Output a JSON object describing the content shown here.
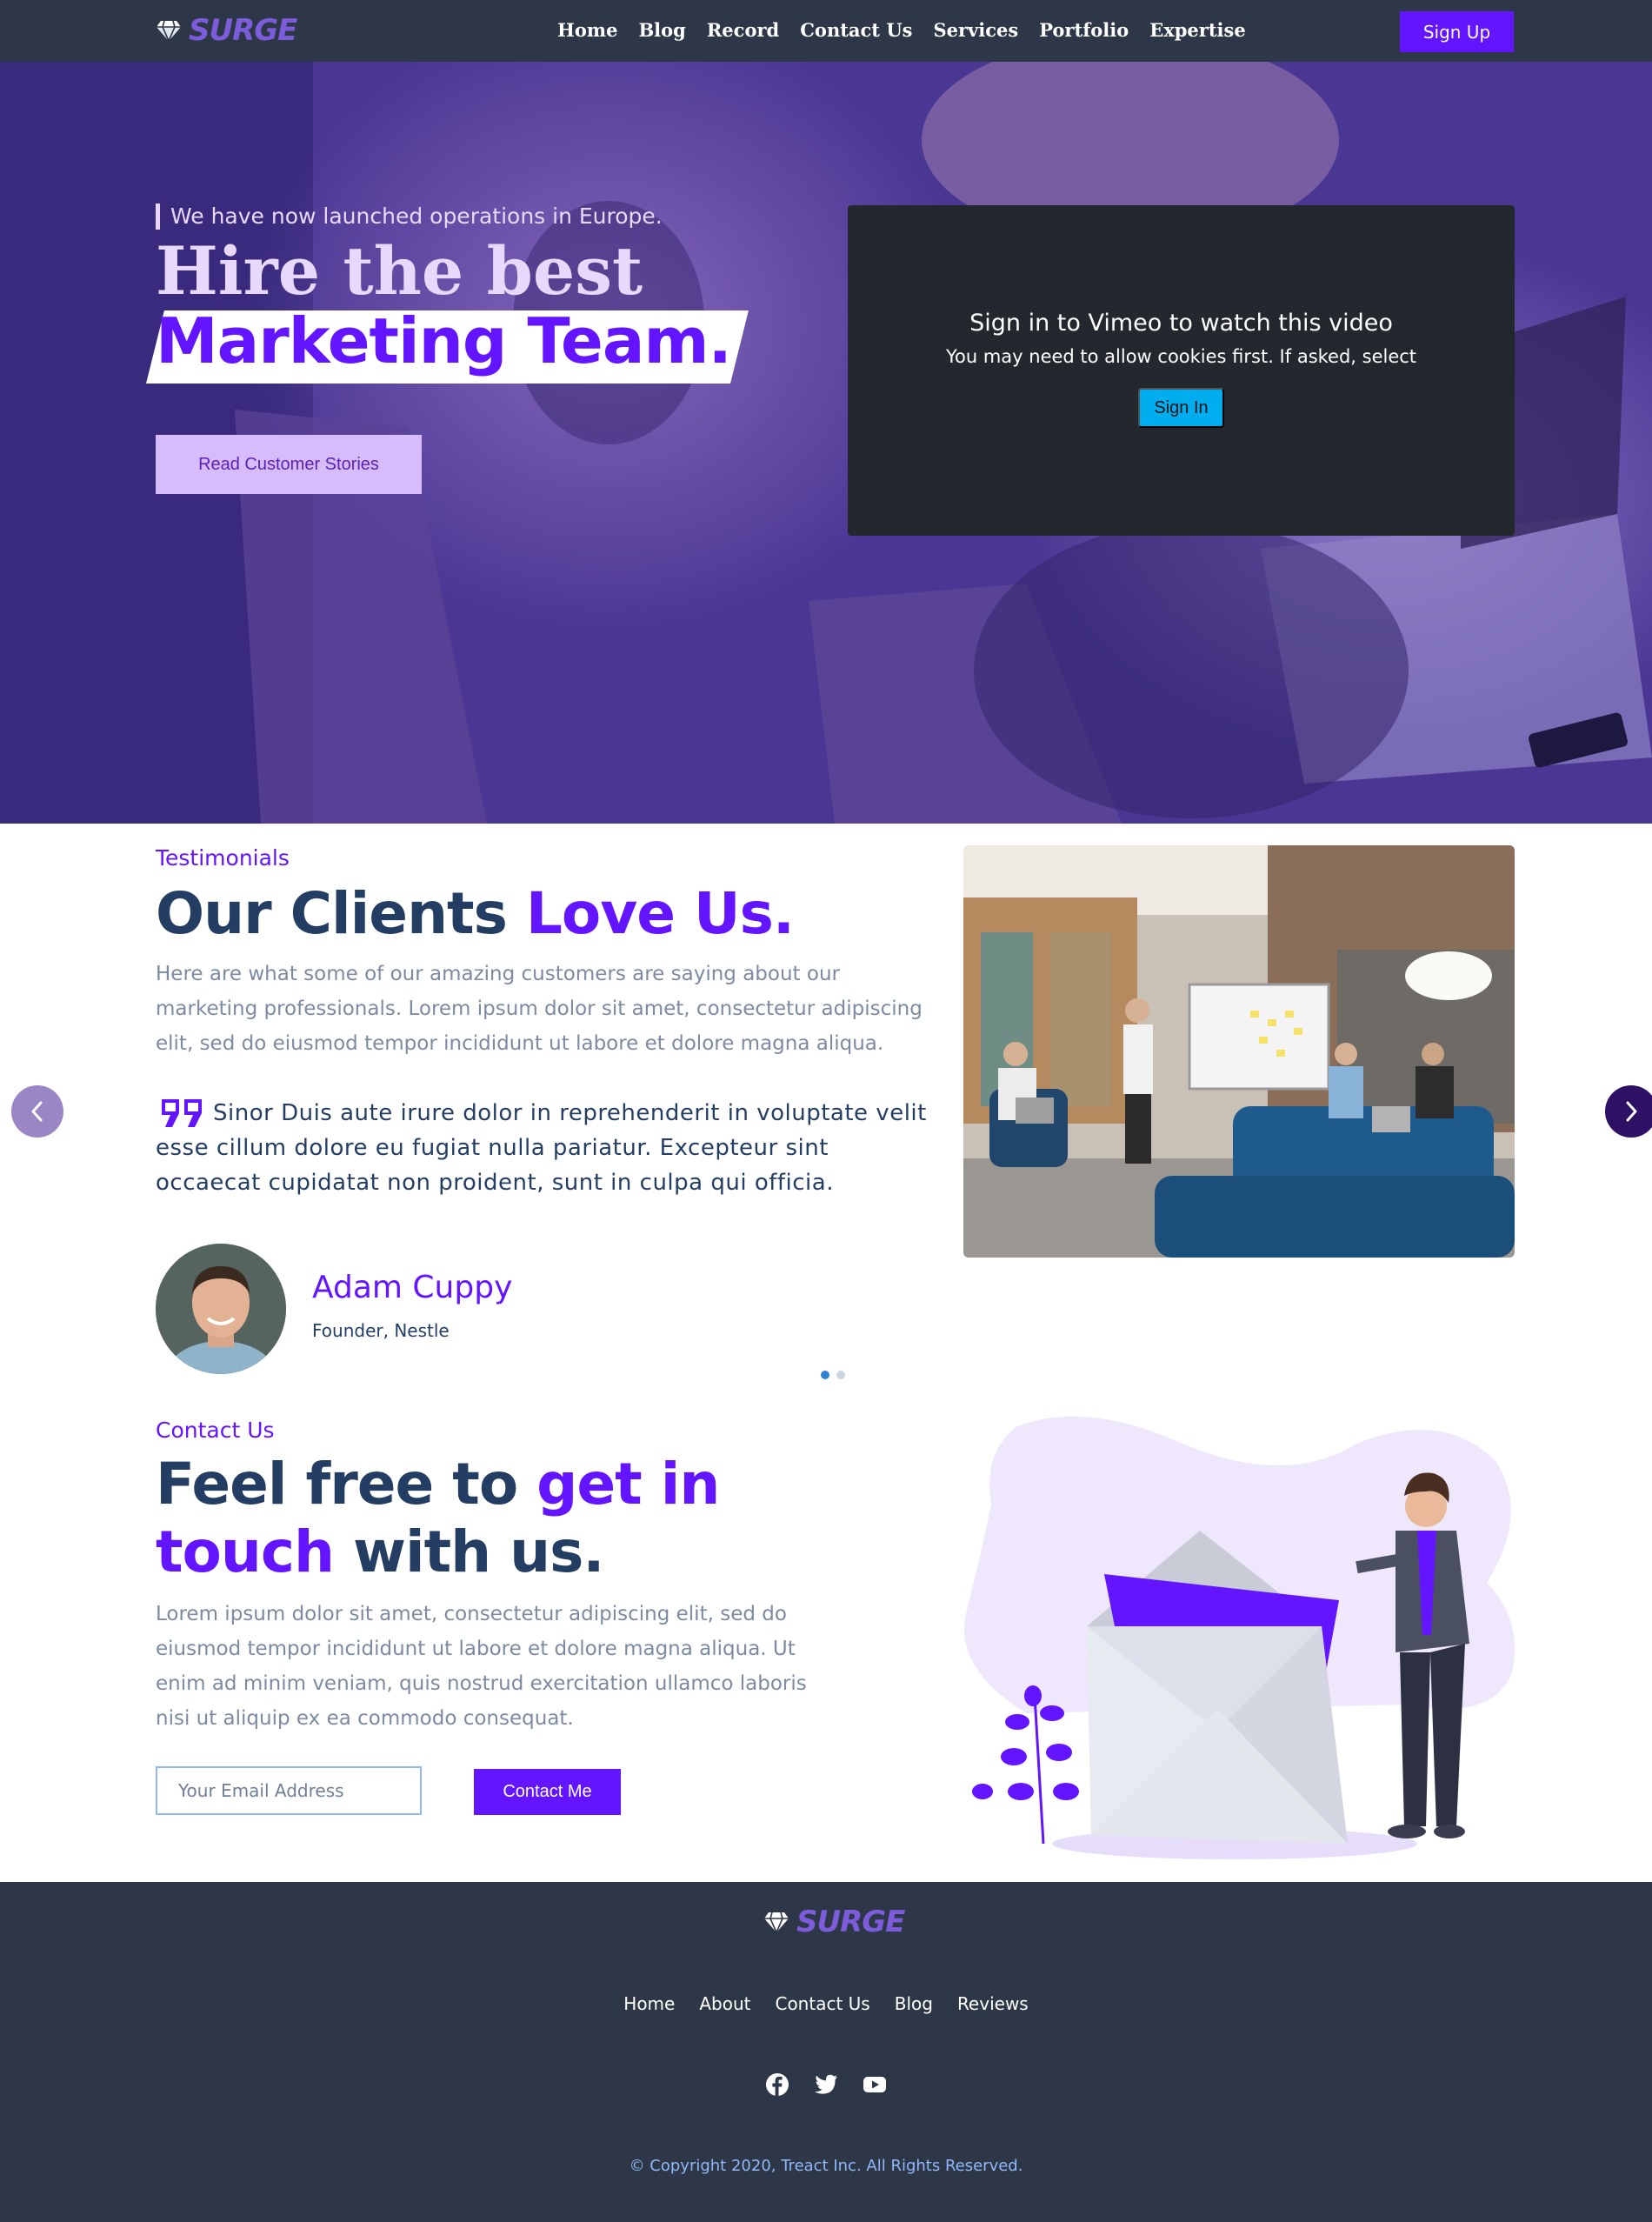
{
  "brand": {
    "name": "SURGE",
    "color": "#7c5cdb",
    "accent": "#6415ff"
  },
  "nav": {
    "links": [
      "Home",
      "Blog",
      "Record",
      "Contact Us",
      "Services",
      "Portfolio",
      "Expertise"
    ],
    "signup_label": "Sign Up"
  },
  "hero": {
    "tagline": "We have now launched operations in Europe.",
    "title_line1": "Hire the best",
    "title_line2": "Marketing Team.",
    "cta_label": "Read Customer Stories"
  },
  "video": {
    "title": "Sign in to Vimeo to watch this video",
    "subtitle": "You may need to allow cookies first. If asked, select",
    "button_label": "Sign In"
  },
  "testimonials": {
    "subheading": "Testimonials",
    "title_plain": "Our Clients ",
    "title_highlight": "Love Us.",
    "description": "Here are what some of our amazing customers are saying about our marketing professionals. Lorem ipsum dolor sit amet, consectetur adipiscing elit, sed do eiusmod tempor incididunt ut labore et dolore magna aliqua.",
    "quote": "Sinor Duis aute irure dolor in reprehenderit in voluptate velit esse cillum dolore eu fugiat nulla pariatur. Excepteur sint occaecat cupidatat non proident, sunt in culpa qui officia.",
    "author_name": "Adam Cuppy",
    "author_role": "Founder, Nestle",
    "slide_count": 2,
    "active_slide": 1
  },
  "contact": {
    "subheading": "Contact Us",
    "title_a": "Feel free to ",
    "title_b": "get in touch",
    "title_c": " with us.",
    "description": "Lorem ipsum dolor sit amet, consectetur adipiscing elit, sed do eiusmod tempor incididunt ut labore et dolore magna aliqua. Ut enim ad minim veniam, quis nostrud exercitation ullamco laboris nisi ut aliquip ex ea commodo consequat.",
    "email_placeholder": "Your Email Address",
    "button_label": "Contact Me"
  },
  "footer": {
    "links": [
      "Home",
      "About",
      "Contact Us",
      "Blog",
      "Reviews"
    ],
    "socials": [
      "facebook-icon",
      "twitter-icon",
      "youtube-icon"
    ],
    "copyright": "© Copyright 2020, Treact Inc. All Rights Reserved."
  }
}
